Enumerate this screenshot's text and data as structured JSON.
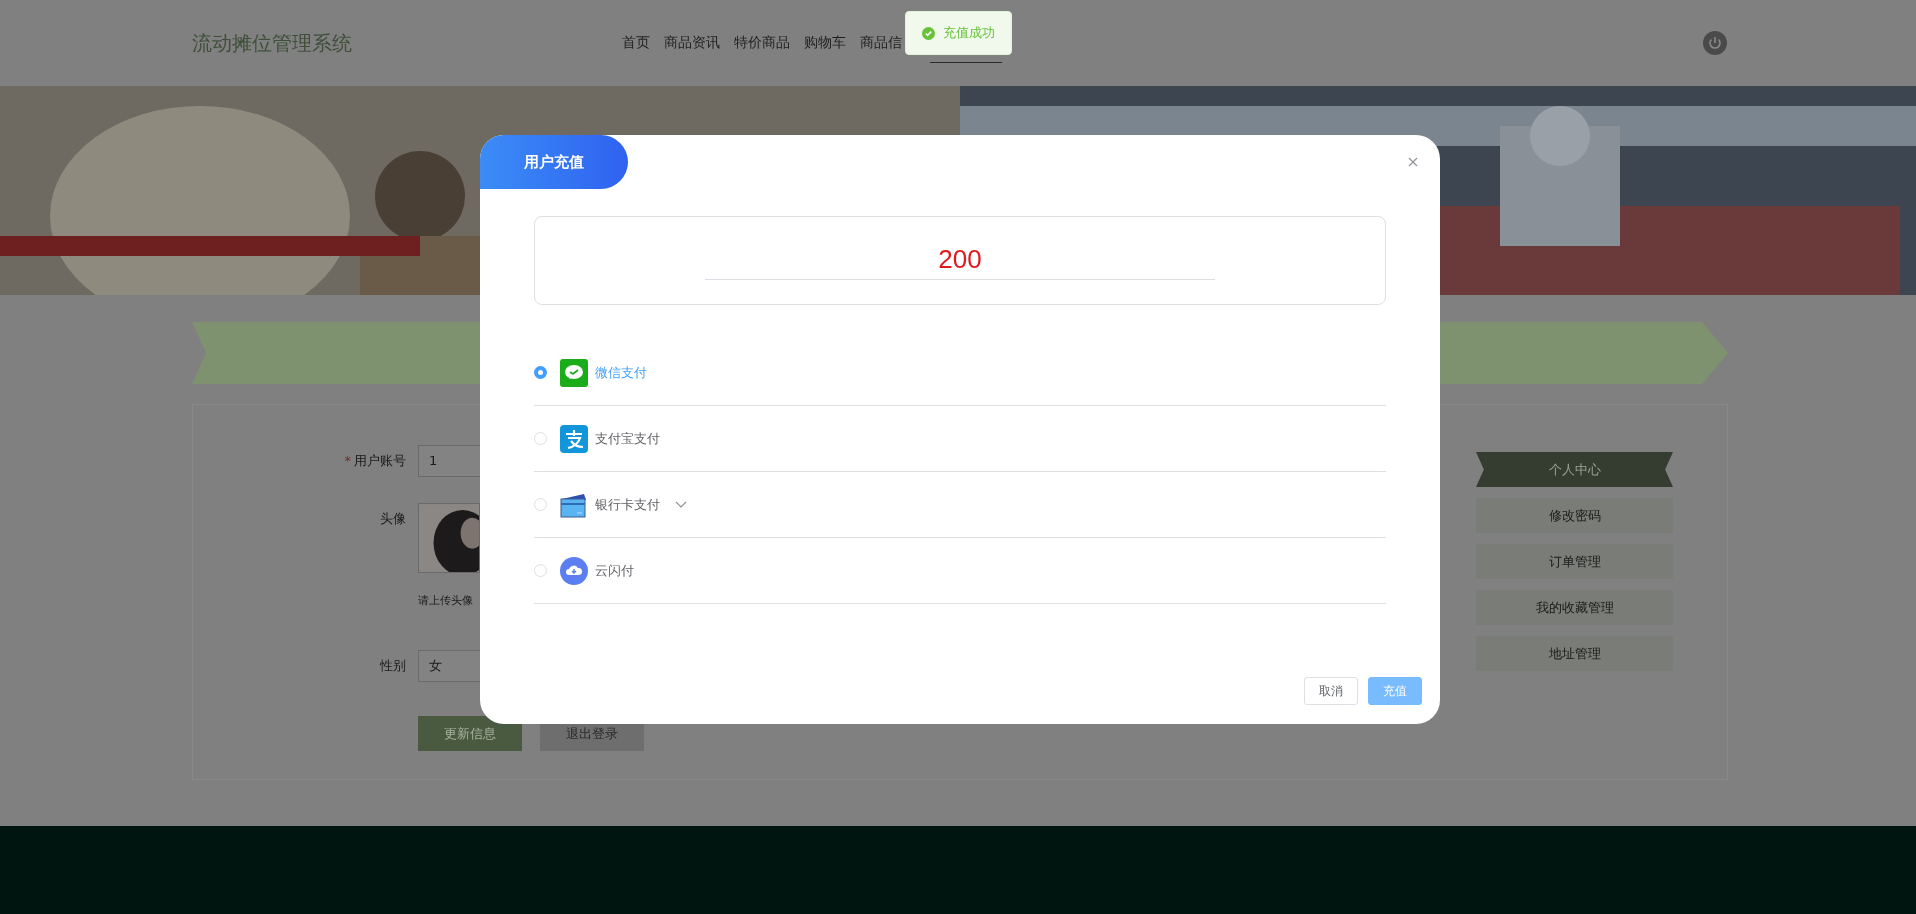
{
  "header": {
    "title": "流动摊位管理系统",
    "nav": [
      {
        "label": "首页"
      },
      {
        "label": "商品资讯"
      },
      {
        "label": "特价商品"
      },
      {
        "label": "购物车"
      },
      {
        "label": "商品信"
      }
    ]
  },
  "toast": {
    "kind": "success",
    "message": "充值成功"
  },
  "profile": {
    "account": {
      "label": "用户账号",
      "required_mark": "*",
      "value": "1"
    },
    "avatar": {
      "label": "头像",
      "hint": "请上传头像"
    },
    "gender": {
      "label": "性别",
      "value": "女"
    },
    "buttons": [
      "更新信息",
      "退出登录"
    ]
  },
  "sidebar": {
    "title": "个人中心",
    "items": [
      "修改密码",
      "订单管理",
      "我的收藏管理",
      "地址管理"
    ]
  },
  "dialog": {
    "title": "用户充值",
    "amount": "200",
    "methods": [
      {
        "kind": "wechat",
        "label": "微信支付",
        "selected": true
      },
      {
        "kind": "alipay",
        "label": "支付宝支付",
        "selected": false
      },
      {
        "kind": "bankcard",
        "label": "银行卡支付",
        "selected": false,
        "expandable": true
      },
      {
        "kind": "unionpay",
        "label": "云闪付",
        "selected": false
      }
    ],
    "buttons": [
      {
        "kind": "cancel",
        "label": "取消"
      },
      {
        "kind": "confirm",
        "label": "充值"
      }
    ]
  }
}
